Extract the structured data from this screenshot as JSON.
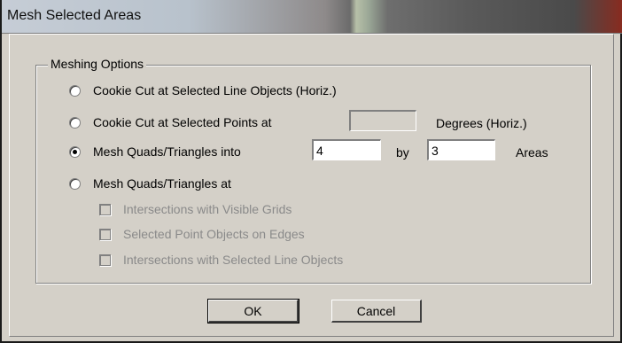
{
  "window": {
    "title": "Mesh Selected Areas"
  },
  "group": {
    "label": "Meshing Options"
  },
  "options": {
    "cookie_lines": "Cookie Cut at Selected Line Objects (Horiz.)",
    "cookie_points": "Cookie Cut at Selected Points at",
    "cookie_points_value": "",
    "cookie_points_suffix": "Degrees (Horiz.)",
    "mesh_into": "Mesh Quads/Triangles into",
    "mesh_into_a": "4",
    "mesh_into_by": "by",
    "mesh_into_b": "3",
    "mesh_into_suffix": "Areas",
    "mesh_at": "Mesh Quads/Triangles at",
    "selected": "mesh_into"
  },
  "suboptions": {
    "visible_grids": "Intersections with Visible Grids",
    "point_objects": "Selected Point Objects on Edges",
    "line_objects": "Intersections with Selected Line Objects"
  },
  "buttons": {
    "ok": "OK",
    "cancel": "Cancel"
  }
}
